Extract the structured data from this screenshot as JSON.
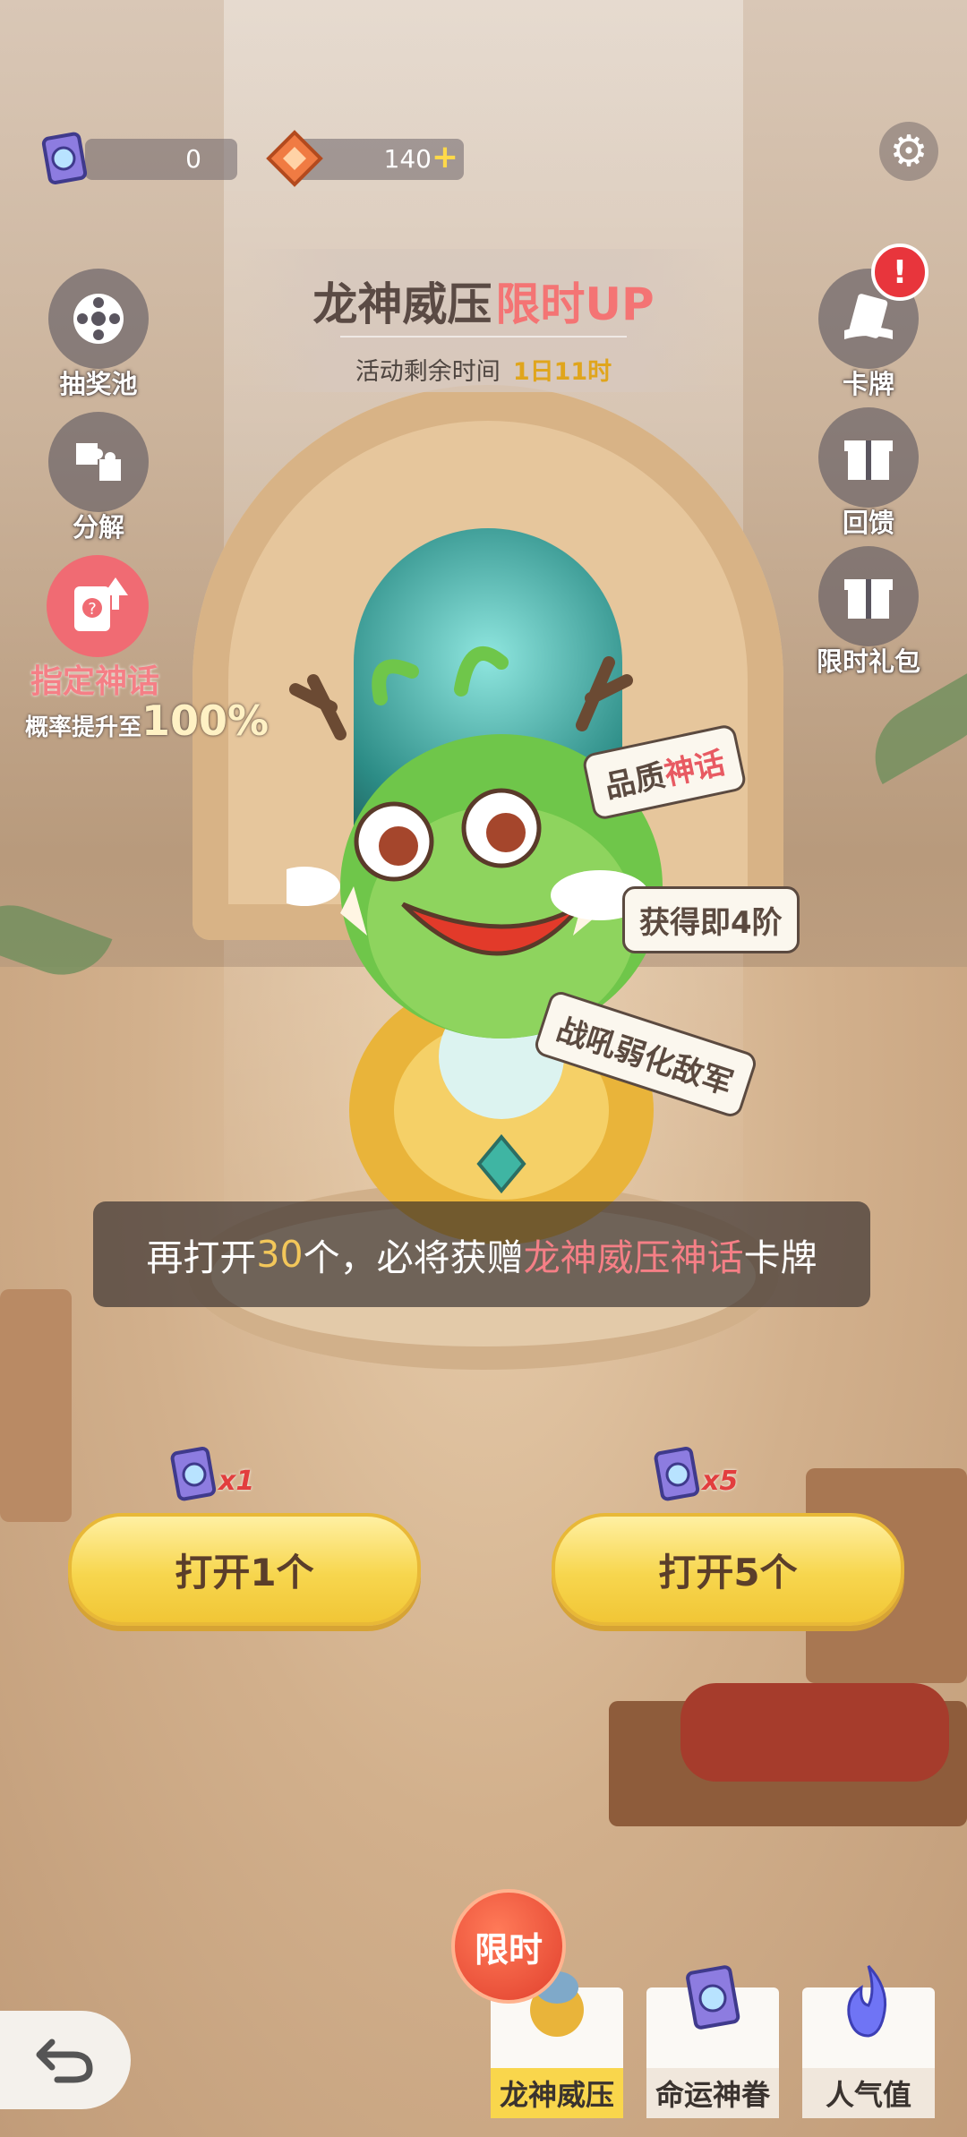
{
  "currency": {
    "tickets": "0",
    "gems": "140",
    "gems_add": "+"
  },
  "banner": {
    "title_main": "龙神威压",
    "title_highlight": "限时UP",
    "remaining_label": "活动剩余时间",
    "remaining_time": "1日11时"
  },
  "left_menu": {
    "pool": "抽奖池",
    "decompose": "分解",
    "designate_title": "指定神话",
    "designate_rate_prefix": "概率提升至",
    "designate_rate_value": "100%"
  },
  "right_menu": {
    "cards": "卡牌",
    "feedback": "回馈",
    "gift_pack": "限时礼包",
    "cards_badge": "!"
  },
  "hero_tags": {
    "quality_prefix": "品质",
    "quality_value": "神话",
    "tier": "获得即4阶",
    "skill": "战吼弱化敌军"
  },
  "notice": {
    "part1": "再打开",
    "count": "30",
    "part2": "个，必将获赠",
    "reward": "龙神威压神话",
    "part3": "卡牌"
  },
  "open_buttons": {
    "one_label": "打开1个",
    "one_cost": "x1",
    "five_label": "打开5个",
    "five_cost": "x5"
  },
  "bottom_tabs": {
    "limited_badge": "限时",
    "tab1": "龙神威压",
    "tab2": "命运神眷",
    "tab3": "人气值"
  },
  "colors": {
    "accent_pink": "#f57f86",
    "button_yellow": "#f7d64e",
    "time_gold": "#e0a51c"
  }
}
